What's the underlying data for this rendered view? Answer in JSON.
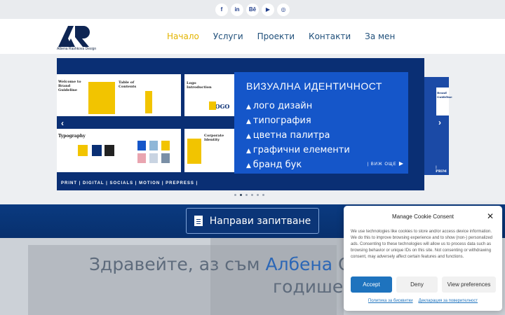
{
  "social": [
    {
      "icon": "facebook-icon",
      "glyph": "f"
    },
    {
      "icon": "linkedin-icon",
      "glyph": "in"
    },
    {
      "icon": "behance-icon",
      "glyph": "Bē"
    },
    {
      "icon": "youtube-icon",
      "glyph": "▶"
    },
    {
      "icon": "instagram-icon",
      "glyph": "◎"
    }
  ],
  "brand": {
    "tagline": "Albena Rashkova Design"
  },
  "nav": {
    "items": [
      "Начало",
      "Услуги",
      "Проекти",
      "Контакти",
      "За мен"
    ],
    "active": "Начало"
  },
  "slider": {
    "books": {
      "b1": "Welcome to Brand Guideline",
      "b2": "Table of Contents",
      "b3": "Logo Introduction",
      "b3_logo": "LOGO",
      "b4": "Typography",
      "b6": "Corporate Identity",
      "next": "Brand Guideline"
    },
    "panel_title": "ВИЗУАЛНА ИДЕНТИЧНОСТ",
    "panel_items": [
      "лого дизайн",
      "типография",
      "цветна палитра",
      "графични елементи",
      "бранд бук"
    ],
    "more": "| ВИЖ ОЩЕ",
    "footer": "PRINT | DIGITAL | SOCIALS | MOTION | PREPRESS |",
    "next_footer": "| PRIM",
    "prev_arrow": "‹",
    "next_arrow": "›",
    "dots": 6,
    "active_dot": 2
  },
  "cta": {
    "label": "Направи запитване"
  },
  "hero": {
    "line1_before": "Здравейте, аз съм ",
    "name": "Албена",
    "line1_after": " С",
    "line2": "годишен опит"
  },
  "cookie": {
    "title": "Manage Cookie Consent",
    "body": "We use technologies like cookies to store and/or access device information. We do this to improve browsing experience and to show (non-) personalized ads. Consenting to these technologies will allow us to process data such as browsing behavior or unique IDs on this site. Not consenting or withdrawing consent, may adversely affect certain features and functions.",
    "accept": "Accept",
    "deny": "Deny",
    "preferences": "View preferences",
    "link_cookies": "Политика за бисквитки",
    "link_privacy": "Декларация за поверителност"
  },
  "colors": {
    "accent": "#e3b400",
    "brand_blue": "#0a2f74",
    "link": "#1e73be"
  }
}
